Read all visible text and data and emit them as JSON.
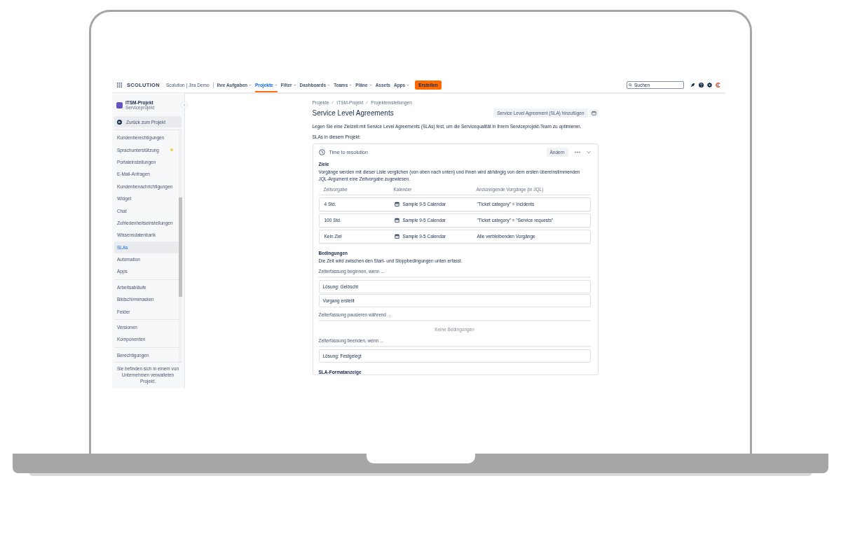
{
  "nav": {
    "logo": "SCOLUTION",
    "site": "Scolution | Jira Demo",
    "items": [
      {
        "label": "Ihre Aufgaben",
        "dropdown": true,
        "selected": false
      },
      {
        "label": "Projekte",
        "dropdown": true,
        "selected": true
      },
      {
        "label": "Filter",
        "dropdown": true,
        "selected": false
      },
      {
        "label": "Dashboards",
        "dropdown": true,
        "selected": false
      },
      {
        "label": "Teams",
        "dropdown": true,
        "selected": false
      },
      {
        "label": "Pläne",
        "dropdown": true,
        "selected": false
      },
      {
        "label": "Assets",
        "dropdown": false,
        "selected": false
      },
      {
        "label": "Apps",
        "dropdown": true,
        "selected": false
      }
    ],
    "create": "Erstellen",
    "search": {
      "placeholder": "Suchen"
    }
  },
  "sidebar": {
    "project": "ITSM-Projekt",
    "type": "Serviceprojekt",
    "back": "Zurück zum Projekt",
    "groups": [
      [
        {
          "label": "Kundenberechtigungen",
          "selected": false,
          "dot": false
        },
        {
          "label": "Sprachunterstützung",
          "selected": false,
          "dot": true
        },
        {
          "label": "Portaleinstellungen",
          "selected": false,
          "dot": false
        },
        {
          "label": "E-Mail-Anfragen",
          "selected": false,
          "dot": false
        },
        {
          "label": "Kundenbenachrichtigungen",
          "selected": false,
          "dot": false
        },
        {
          "label": "Widget",
          "selected": false,
          "dot": false
        },
        {
          "label": "Chat",
          "selected": false,
          "dot": false
        },
        {
          "label": "Zufriedenheitseinstellungen",
          "selected": false,
          "dot": false
        },
        {
          "label": "Wissensdatenbank",
          "selected": false,
          "dot": false
        },
        {
          "label": "SLAs",
          "selected": true,
          "dot": false
        },
        {
          "label": "Automation",
          "selected": false,
          "dot": false
        },
        {
          "label": "Apps",
          "selected": false,
          "dot": false
        }
      ],
      [
        {
          "label": "Arbeitsabläufe",
          "selected": false,
          "dot": false
        },
        {
          "label": "Bildschirmmasken",
          "selected": false,
          "dot": false
        },
        {
          "label": "Felder",
          "selected": false,
          "dot": false
        }
      ],
      [
        {
          "label": "Versionen",
          "selected": false,
          "dot": false
        },
        {
          "label": "Komponenten",
          "selected": false,
          "dot": false
        }
      ],
      [
        {
          "label": "Berechtigungen",
          "selected": false,
          "dot": false
        }
      ]
    ],
    "footer": "Sie befinden sich in einem von Unternehmen verwalteten Projekt."
  },
  "breadcrumbs": [
    "Projekte",
    "ITSM-Projekt",
    "Projekteinstellungen"
  ],
  "title": "Service Level Agreements",
  "add_button": "Service Level Agreement (SLA) hinzufügen",
  "intro": "Legen Sie eine Zielzeit mit Service Level Agreements (SLAs) fest, um die Servicequalität in Ihrem Serviceprojekt-Team zu optimieren.",
  "list_label": "SLAs in diesem Projekt:",
  "sla": {
    "name": "Time to resolution",
    "edit": "Ändern",
    "expanded": true,
    "goals": {
      "heading": "Ziele",
      "description": "Vorgänge werden mit dieser Liste verglichen (von oben nach unten) und ihnen wird abhängig von dem ersten übereinstimmenden JQL-Argument eine Zeitvorgabe zugewiesen.",
      "columns": [
        "Zeitvorgabe",
        "Kalender",
        "Anzuzeigende Vorgänge (in JQL)"
      ],
      "rows": [
        {
          "target": "4 Std.",
          "calendar": "Sample 9-5 Calendar",
          "jql": "\"Ticket category\" = Incidents"
        },
        {
          "target": "100 Std.",
          "calendar": "Sample 9-5 Calendar",
          "jql": "\"Ticket category\" = \"Service requests\""
        },
        {
          "target": "Kein Ziel",
          "calendar": "Sample 9-5 Calendar",
          "jql": "Alle verbleibenden Vorgänge"
        }
      ]
    },
    "conditions": {
      "heading": "Bedingungen",
      "description": "Die Zeit wird zwischen den Start- und Stoppbedingungen unten erfasst.",
      "groups": [
        {
          "label": "Zeiterfassung beginnen, wenn ...",
          "items": [
            "Lösung: Gelöscht",
            "Vorgang erstellt"
          ]
        },
        {
          "label": "Zeiterfassung pausieren während ...",
          "empty": "Keine Bedingungen"
        },
        {
          "label": "Zeiterfassung beenden, wenn ...",
          "items": [
            "Lösung: Festgelegt"
          ]
        }
      ]
    },
    "format_heading": "SLA-Formatanzeige"
  }
}
